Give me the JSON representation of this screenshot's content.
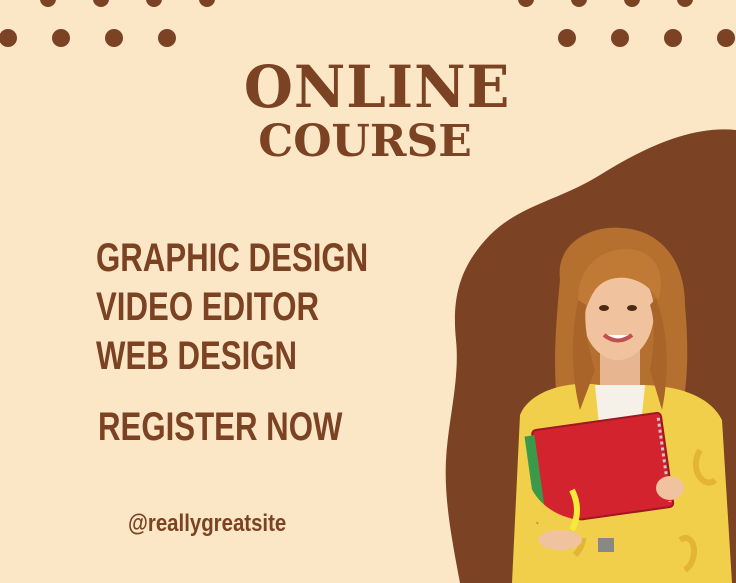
{
  "poster": {
    "title_line1": "ONLINE",
    "title_line2": "COURSE",
    "courses": [
      "GRAPHIC DESIGN",
      "VIDEO EDITOR",
      "WEB DESIGN"
    ],
    "cta": "REGISTER NOW",
    "handle": "@reallygreatsite"
  },
  "colors": {
    "background": "#fbe7c6",
    "accent_brown": "#7b4223"
  },
  "icons": [
    "student-photo",
    "decorative-dots",
    "decorative-blob"
  ]
}
